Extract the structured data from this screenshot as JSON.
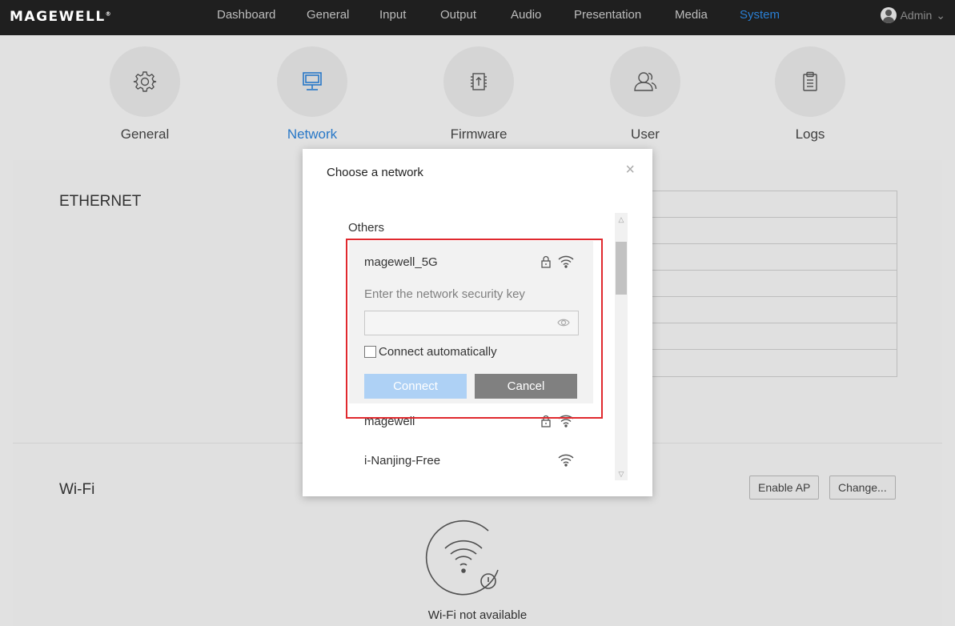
{
  "nav": {
    "logo": "MAGEWELL",
    "logo_mark": "®",
    "items": [
      "Dashboard",
      "General",
      "Input",
      "Output",
      "Audio",
      "Presentation",
      "Media",
      "System"
    ],
    "active": "System",
    "user": "Admin",
    "user_caret": "⌄"
  },
  "tiles": [
    {
      "label": "General",
      "icon": "gear-icon"
    },
    {
      "label": "Network",
      "icon": "monitor-icon",
      "active": true
    },
    {
      "label": "Firmware",
      "icon": "firmware-icon"
    },
    {
      "label": "User",
      "icon": "users-icon"
    },
    {
      "label": "Logs",
      "icon": "clipboard-icon"
    }
  ],
  "ethernet": {
    "title": "ETHERNET"
  },
  "wifi": {
    "title": "Wi-Fi",
    "enable_ap_label": "Enable AP",
    "change_label": "Change...",
    "status": "Wi-Fi not available"
  },
  "modal": {
    "title": "Choose a network",
    "close": "×",
    "section": "Others",
    "selected": {
      "name": "magewell_5G",
      "secured": true,
      "hint": "Enter the network security key",
      "password_value": "",
      "auto_label": "Connect automatically",
      "auto_checked": false,
      "connect_label": "Connect",
      "cancel_label": "Cancel"
    },
    "networks": [
      {
        "name": "magewell",
        "secured": true
      },
      {
        "name": "i-Nanjing-Free",
        "secured": false
      }
    ]
  },
  "colors": {
    "accent": "#2a7fd4",
    "highlight_border": "#e0292e",
    "connect_disabled": "#aed1f5",
    "cancel": "#808080"
  }
}
